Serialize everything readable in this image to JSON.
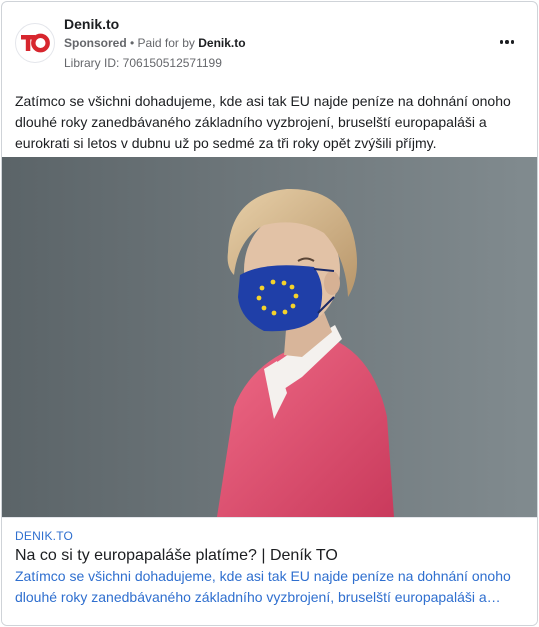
{
  "ad": {
    "page_name": "Denik.to",
    "sponsored_label": "Sponsored",
    "separator": " • ",
    "paid_for_label": "Paid for by ",
    "payer_name": "Denik.to",
    "library_id": "Library ID: 706150512571199",
    "body_text": "Zatímco se všichni dohadujeme, kde asi tak EU najde peníze na dohnání onoho dlouhé roky zanedbávaného základního vyzbrojení, bruselští europapaláši a eurokrati si letos v dubnu už po sedmé za tři roky opět zvýšili příjmy.",
    "logo_text": "TO",
    "logo_color": "#d7262e",
    "more_icon": "more-horizontal-icon"
  },
  "link": {
    "domain": "DENIK.TO",
    "title": "Na co si ty europapaláše platíme? | Deník TO",
    "description": "Zatímco se všichni dohadujeme, kde asi tak EU najde peníze na dohnání onoho dlouhé roky zanedbávaného základního vyzbrojení, bruselští europapaláši a eurokrati si letos v dubnu už po sedmé za tři roky opět zvýšili příjmy."
  },
  "colors": {
    "link_blue": "#2f6fcf",
    "mask_blue": "#1f3fa8",
    "jacket_pink": "#e14e6f",
    "background_gray": "#6b7478"
  }
}
